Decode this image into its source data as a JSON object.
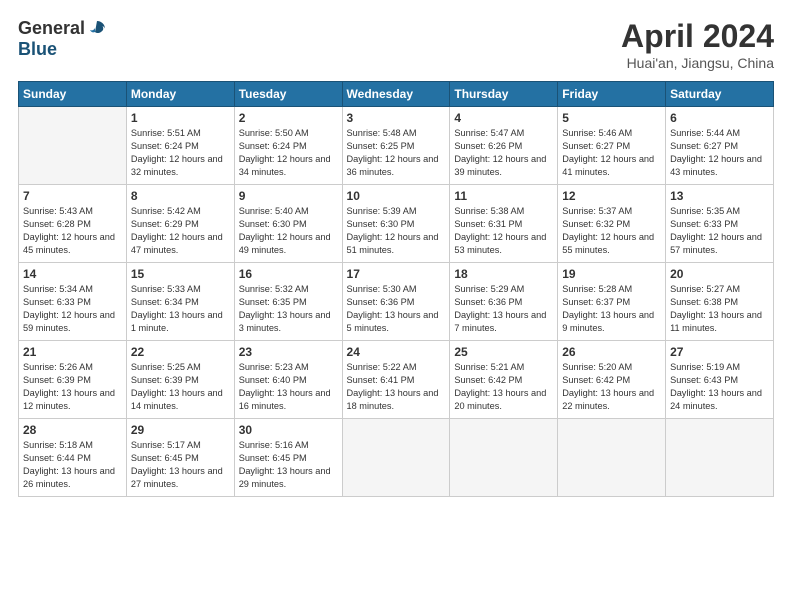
{
  "header": {
    "logo_general": "General",
    "logo_blue": "Blue",
    "title": "April 2024",
    "location": "Huai'an, Jiangsu, China"
  },
  "weekdays": [
    "Sunday",
    "Monday",
    "Tuesday",
    "Wednesday",
    "Thursday",
    "Friday",
    "Saturday"
  ],
  "weeks": [
    [
      {
        "day": "",
        "sunrise": "",
        "sunset": "",
        "daylight": ""
      },
      {
        "day": "1",
        "sunrise": "Sunrise: 5:51 AM",
        "sunset": "Sunset: 6:24 PM",
        "daylight": "Daylight: 12 hours and 32 minutes."
      },
      {
        "day": "2",
        "sunrise": "Sunrise: 5:50 AM",
        "sunset": "Sunset: 6:24 PM",
        "daylight": "Daylight: 12 hours and 34 minutes."
      },
      {
        "day": "3",
        "sunrise": "Sunrise: 5:48 AM",
        "sunset": "Sunset: 6:25 PM",
        "daylight": "Daylight: 12 hours and 36 minutes."
      },
      {
        "day": "4",
        "sunrise": "Sunrise: 5:47 AM",
        "sunset": "Sunset: 6:26 PM",
        "daylight": "Daylight: 12 hours and 39 minutes."
      },
      {
        "day": "5",
        "sunrise": "Sunrise: 5:46 AM",
        "sunset": "Sunset: 6:27 PM",
        "daylight": "Daylight: 12 hours and 41 minutes."
      },
      {
        "day": "6",
        "sunrise": "Sunrise: 5:44 AM",
        "sunset": "Sunset: 6:27 PM",
        "daylight": "Daylight: 12 hours and 43 minutes."
      }
    ],
    [
      {
        "day": "7",
        "sunrise": "Sunrise: 5:43 AM",
        "sunset": "Sunset: 6:28 PM",
        "daylight": "Daylight: 12 hours and 45 minutes."
      },
      {
        "day": "8",
        "sunrise": "Sunrise: 5:42 AM",
        "sunset": "Sunset: 6:29 PM",
        "daylight": "Daylight: 12 hours and 47 minutes."
      },
      {
        "day": "9",
        "sunrise": "Sunrise: 5:40 AM",
        "sunset": "Sunset: 6:30 PM",
        "daylight": "Daylight: 12 hours and 49 minutes."
      },
      {
        "day": "10",
        "sunrise": "Sunrise: 5:39 AM",
        "sunset": "Sunset: 6:30 PM",
        "daylight": "Daylight: 12 hours and 51 minutes."
      },
      {
        "day": "11",
        "sunrise": "Sunrise: 5:38 AM",
        "sunset": "Sunset: 6:31 PM",
        "daylight": "Daylight: 12 hours and 53 minutes."
      },
      {
        "day": "12",
        "sunrise": "Sunrise: 5:37 AM",
        "sunset": "Sunset: 6:32 PM",
        "daylight": "Daylight: 12 hours and 55 minutes."
      },
      {
        "day": "13",
        "sunrise": "Sunrise: 5:35 AM",
        "sunset": "Sunset: 6:33 PM",
        "daylight": "Daylight: 12 hours and 57 minutes."
      }
    ],
    [
      {
        "day": "14",
        "sunrise": "Sunrise: 5:34 AM",
        "sunset": "Sunset: 6:33 PM",
        "daylight": "Daylight: 12 hours and 59 minutes."
      },
      {
        "day": "15",
        "sunrise": "Sunrise: 5:33 AM",
        "sunset": "Sunset: 6:34 PM",
        "daylight": "Daylight: 13 hours and 1 minute."
      },
      {
        "day": "16",
        "sunrise": "Sunrise: 5:32 AM",
        "sunset": "Sunset: 6:35 PM",
        "daylight": "Daylight: 13 hours and 3 minutes."
      },
      {
        "day": "17",
        "sunrise": "Sunrise: 5:30 AM",
        "sunset": "Sunset: 6:36 PM",
        "daylight": "Daylight: 13 hours and 5 minutes."
      },
      {
        "day": "18",
        "sunrise": "Sunrise: 5:29 AM",
        "sunset": "Sunset: 6:36 PM",
        "daylight": "Daylight: 13 hours and 7 minutes."
      },
      {
        "day": "19",
        "sunrise": "Sunrise: 5:28 AM",
        "sunset": "Sunset: 6:37 PM",
        "daylight": "Daylight: 13 hours and 9 minutes."
      },
      {
        "day": "20",
        "sunrise": "Sunrise: 5:27 AM",
        "sunset": "Sunset: 6:38 PM",
        "daylight": "Daylight: 13 hours and 11 minutes."
      }
    ],
    [
      {
        "day": "21",
        "sunrise": "Sunrise: 5:26 AM",
        "sunset": "Sunset: 6:39 PM",
        "daylight": "Daylight: 13 hours and 12 minutes."
      },
      {
        "day": "22",
        "sunrise": "Sunrise: 5:25 AM",
        "sunset": "Sunset: 6:39 PM",
        "daylight": "Daylight: 13 hours and 14 minutes."
      },
      {
        "day": "23",
        "sunrise": "Sunrise: 5:23 AM",
        "sunset": "Sunset: 6:40 PM",
        "daylight": "Daylight: 13 hours and 16 minutes."
      },
      {
        "day": "24",
        "sunrise": "Sunrise: 5:22 AM",
        "sunset": "Sunset: 6:41 PM",
        "daylight": "Daylight: 13 hours and 18 minutes."
      },
      {
        "day": "25",
        "sunrise": "Sunrise: 5:21 AM",
        "sunset": "Sunset: 6:42 PM",
        "daylight": "Daylight: 13 hours and 20 minutes."
      },
      {
        "day": "26",
        "sunrise": "Sunrise: 5:20 AM",
        "sunset": "Sunset: 6:42 PM",
        "daylight": "Daylight: 13 hours and 22 minutes."
      },
      {
        "day": "27",
        "sunrise": "Sunrise: 5:19 AM",
        "sunset": "Sunset: 6:43 PM",
        "daylight": "Daylight: 13 hours and 24 minutes."
      }
    ],
    [
      {
        "day": "28",
        "sunrise": "Sunrise: 5:18 AM",
        "sunset": "Sunset: 6:44 PM",
        "daylight": "Daylight: 13 hours and 26 minutes."
      },
      {
        "day": "29",
        "sunrise": "Sunrise: 5:17 AM",
        "sunset": "Sunset: 6:45 PM",
        "daylight": "Daylight: 13 hours and 27 minutes."
      },
      {
        "day": "30",
        "sunrise": "Sunrise: 5:16 AM",
        "sunset": "Sunset: 6:45 PM",
        "daylight": "Daylight: 13 hours and 29 minutes."
      },
      {
        "day": "",
        "sunrise": "",
        "sunset": "",
        "daylight": ""
      },
      {
        "day": "",
        "sunrise": "",
        "sunset": "",
        "daylight": ""
      },
      {
        "day": "",
        "sunrise": "",
        "sunset": "",
        "daylight": ""
      },
      {
        "day": "",
        "sunrise": "",
        "sunset": "",
        "daylight": ""
      }
    ]
  ]
}
